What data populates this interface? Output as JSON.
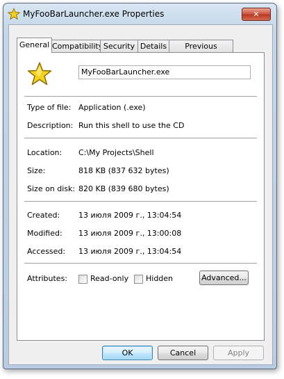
{
  "window": {
    "title": "MyFooBarLauncher.exe Properties",
    "close_label": "✕"
  },
  "tabs": [
    {
      "label": "General",
      "active": true
    },
    {
      "label": "Compatibility",
      "active": false
    },
    {
      "label": "Security",
      "active": false
    },
    {
      "label": "Details",
      "active": false
    },
    {
      "label": "Previous Versions",
      "active": false
    }
  ],
  "general": {
    "file_name": "MyFooBarLauncher.exe",
    "file_icon": "star-icon",
    "type_label": "Type of file:",
    "type_value": "Application (.exe)",
    "description_label": "Description:",
    "description_value": "Run this shell to use the CD",
    "location_label": "Location:",
    "location_value": "C:\\My Projects\\Shell",
    "size_label": "Size:",
    "size_value": "818 KB (837 632 bytes)",
    "size_on_disk_label": "Size on disk:",
    "size_on_disk_value": "820 KB (839 680 bytes)",
    "created_label": "Created:",
    "created_value": "13 июля 2009 г., 13:04:54",
    "modified_label": "Modified:",
    "modified_value": "13 июля 2009 г., 13:00:08",
    "accessed_label": "Accessed:",
    "accessed_value": "13 июля 2009 г., 13:04:54",
    "attributes_label": "Attributes:",
    "readonly_label": "Read-only",
    "hidden_label": "Hidden",
    "advanced_label": "Advanced..."
  },
  "buttons": {
    "ok": "OK",
    "cancel": "Cancel",
    "apply": "Apply"
  },
  "colors": {
    "star": "#f4d21c",
    "window_frame": "#b9cde2",
    "close": "#c9462c"
  }
}
